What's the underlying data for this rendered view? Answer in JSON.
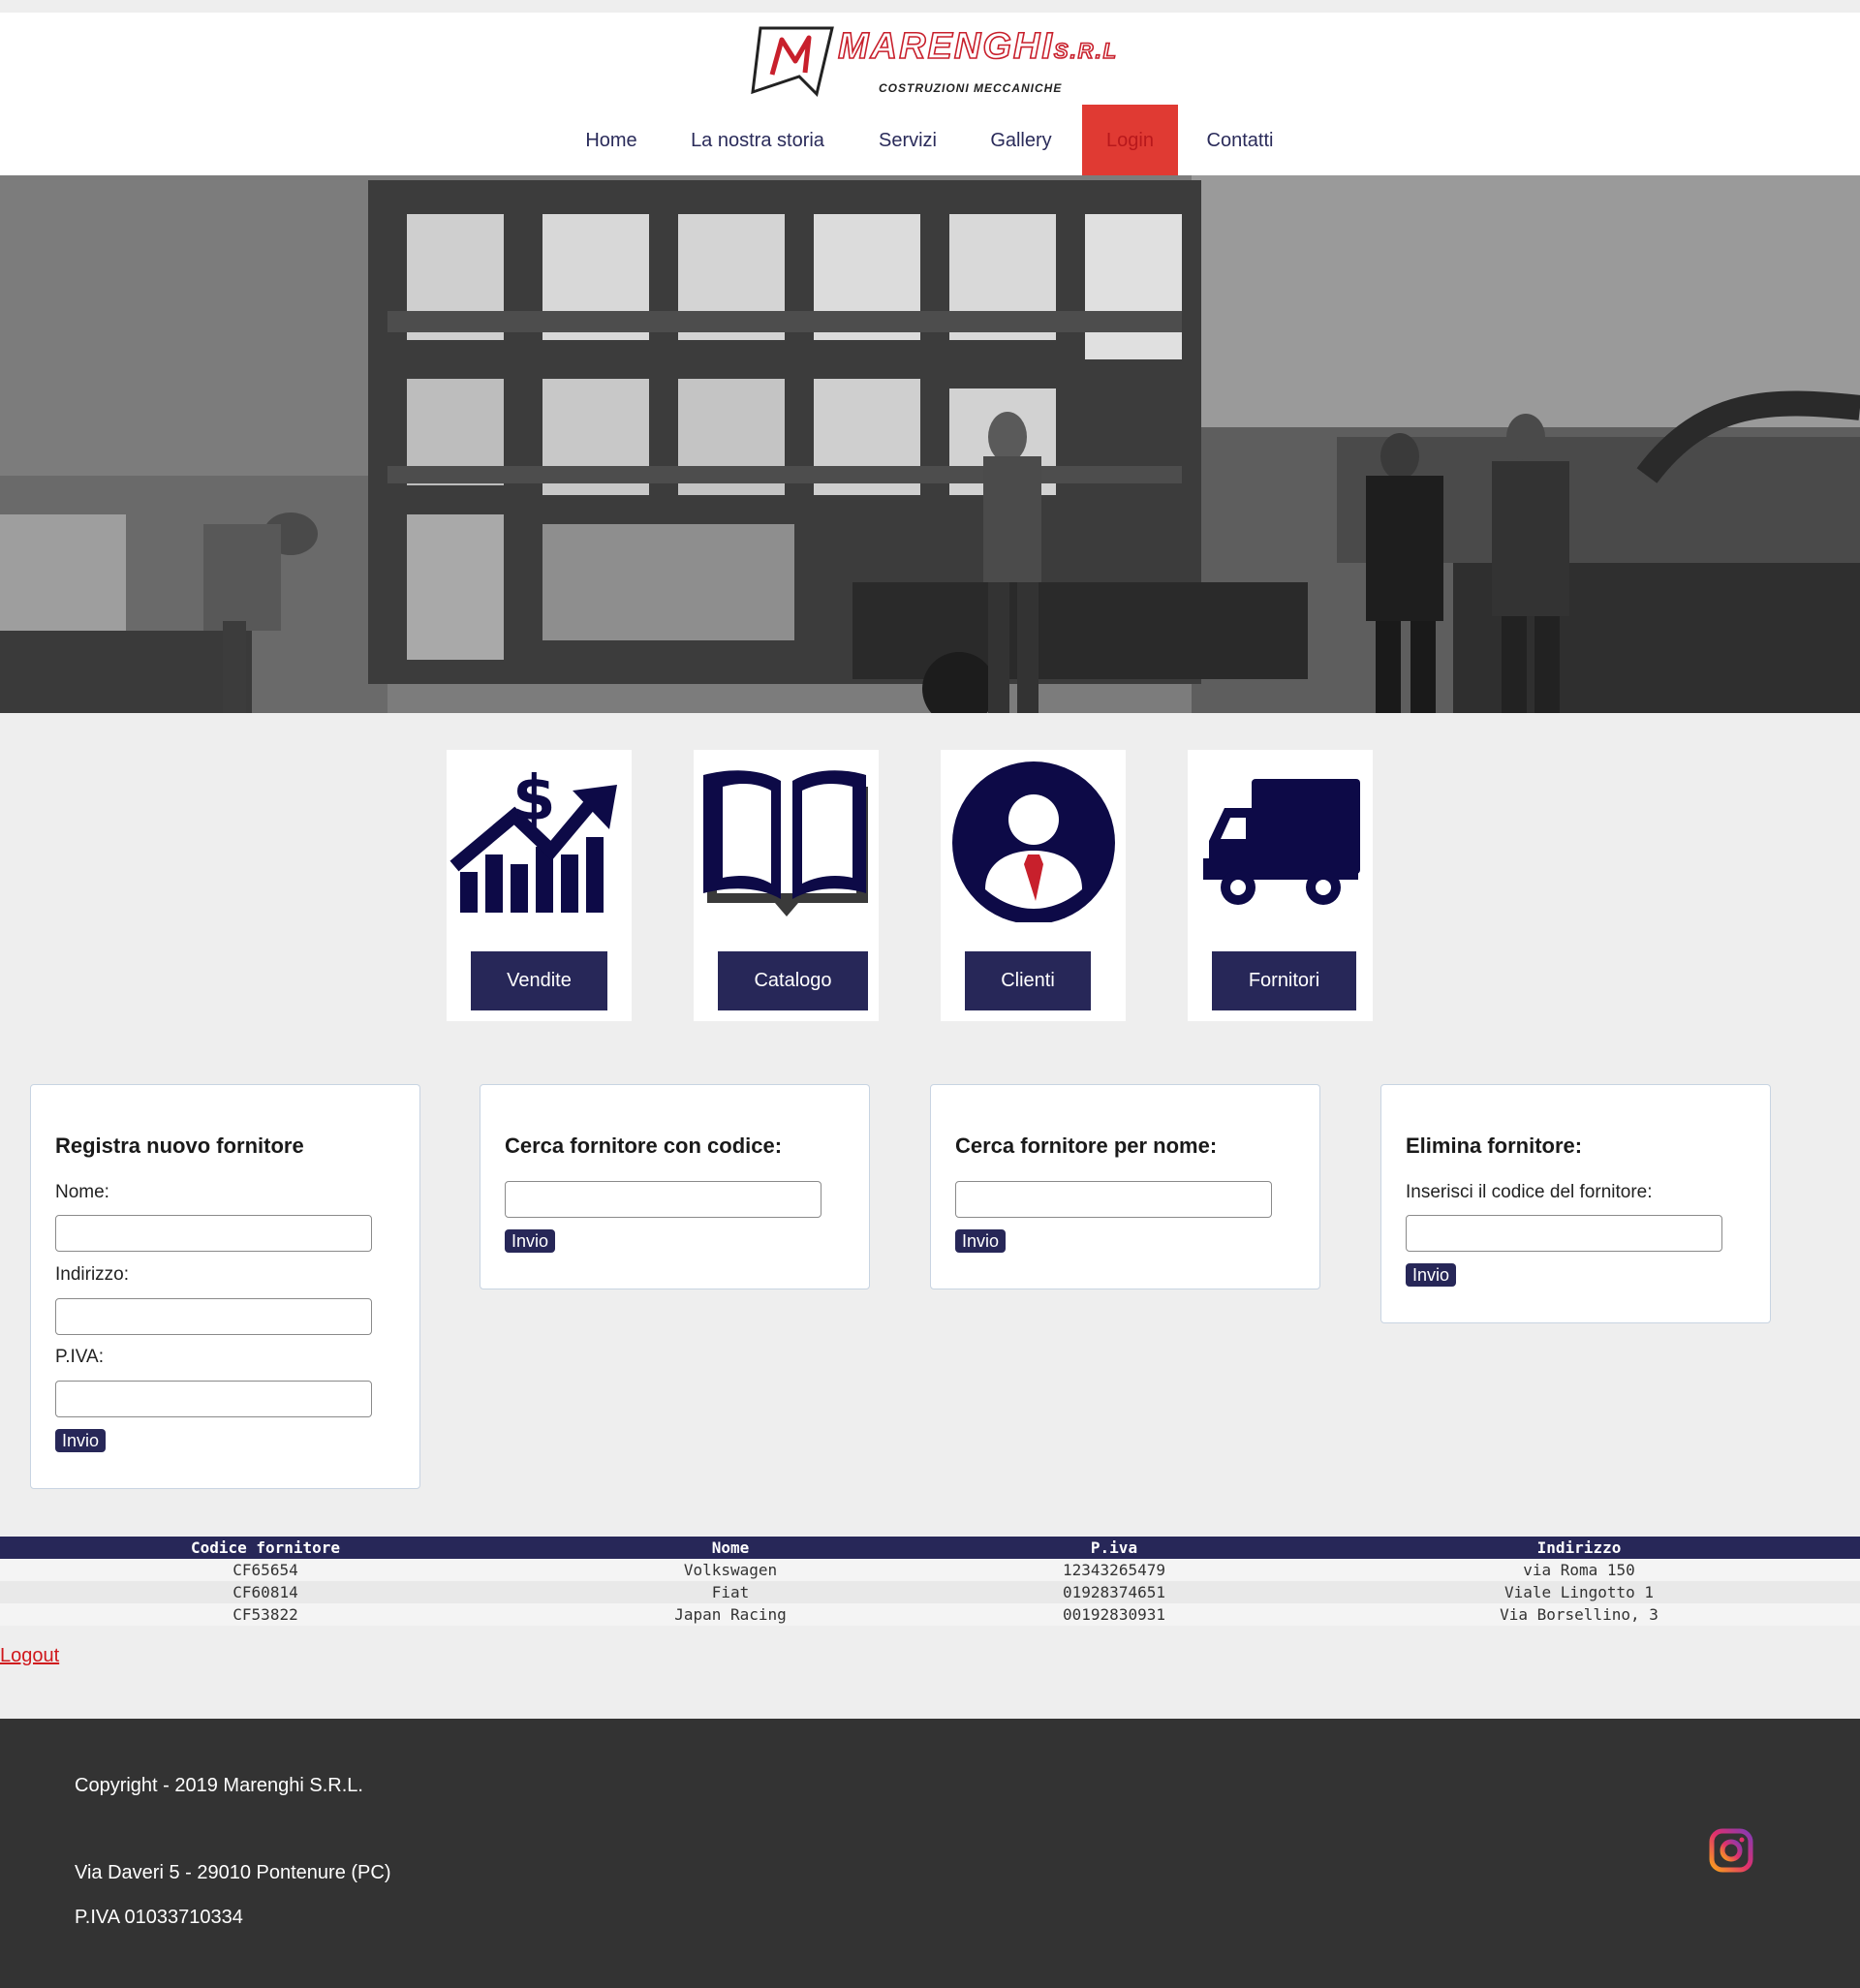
{
  "header": {
    "logo_name": "MARENGHI",
    "logo_suffix": "S.R.L",
    "logo_subtitle": "COSTRUZIONI MECCANICHE"
  },
  "nav": {
    "items": [
      "Home",
      "La nostra storia",
      "Servizi",
      "Gallery",
      "Login",
      "Contatti"
    ],
    "active": "Login"
  },
  "tiles": [
    {
      "label": "Vendite",
      "icon": "sales-chart-icon"
    },
    {
      "label": "Catalogo",
      "icon": "book-icon"
    },
    {
      "label": "Clienti",
      "icon": "user-icon"
    },
    {
      "label": "Fornitori",
      "icon": "truck-icon"
    }
  ],
  "forms": {
    "register": {
      "title": "Registra nuovo fornitore",
      "name_label": "Nome:",
      "address_label": "Indirizzo:",
      "vat_label": "P.IVA:",
      "submit": "Invio"
    },
    "search_code": {
      "title": "Cerca fornitore con codice:",
      "submit": "Invio"
    },
    "search_name": {
      "title": "Cerca fornitore per nome:",
      "submit": "Invio"
    },
    "delete": {
      "title": "Elimina fornitore:",
      "code_label": "Inserisci il codice del fornitore:",
      "submit": "Invio"
    }
  },
  "table": {
    "headers": [
      "Codice fornitore",
      "Nome",
      "P.iva",
      "Indirizzo"
    ],
    "rows": [
      [
        "CF65654",
        "Volkswagen",
        "12343265479",
        "via Roma 150"
      ],
      [
        "CF60814",
        "Fiat",
        "01928374651",
        "Viale Lingotto 1"
      ],
      [
        "CF53822",
        "Japan Racing",
        "00192830931",
        "Via Borsellino, 3"
      ]
    ]
  },
  "logout": "Logout",
  "footer": {
    "copyright": "Copyright - 2019 Marenghi S.R.L.",
    "address": "Via Daveri 5 - 29010 Pontenure (PC)",
    "vat": "P.IVA 01033710334",
    "social_icon": "instagram-icon"
  },
  "colors": {
    "primary": "#272758",
    "accent": "#e03a33",
    "footer": "#333333",
    "icon": "#0d0a47"
  }
}
